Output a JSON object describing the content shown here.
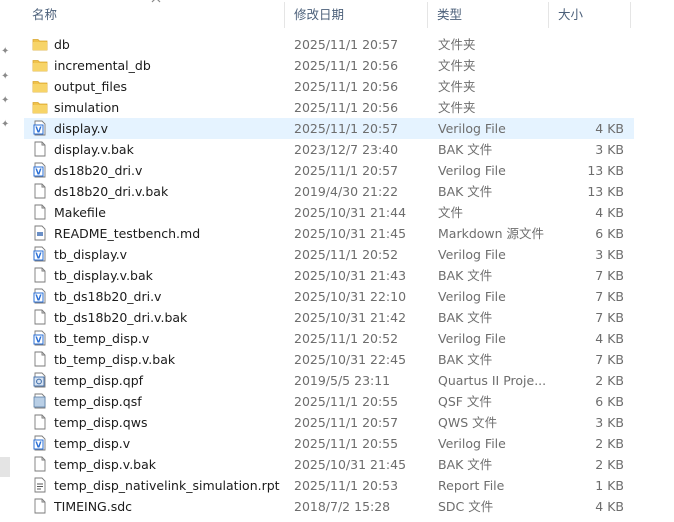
{
  "header": {
    "name": "名称",
    "date": "修改日期",
    "type": "类型",
    "size": "大小"
  },
  "files": [
    {
      "name": "db",
      "date": "2025/11/1 20:57",
      "type": "文件夹",
      "size": "",
      "icon": "folder-icon"
    },
    {
      "name": "incremental_db",
      "date": "2025/11/1 20:56",
      "type": "文件夹",
      "size": "",
      "icon": "folder-icon"
    },
    {
      "name": "output_files",
      "date": "2025/11/1 20:56",
      "type": "文件夹",
      "size": "",
      "icon": "folder-icon"
    },
    {
      "name": "simulation",
      "date": "2025/11/1 20:56",
      "type": "文件夹",
      "size": "",
      "icon": "folder-icon"
    },
    {
      "name": "display.v",
      "date": "2025/11/1 20:57",
      "type": "Verilog File",
      "size": "4 KB",
      "icon": "verilog-file-icon",
      "selected": true
    },
    {
      "name": "display.v.bak",
      "date": "2023/12/7 23:40",
      "type": "BAK 文件",
      "size": "3 KB",
      "icon": "file-icon"
    },
    {
      "name": "ds18b20_dri.v",
      "date": "2025/11/1 20:57",
      "type": "Verilog File",
      "size": "13 KB",
      "icon": "verilog-file-icon"
    },
    {
      "name": "ds18b20_dri.v.bak",
      "date": "2019/4/30 21:22",
      "type": "BAK 文件",
      "size": "13 KB",
      "icon": "file-icon"
    },
    {
      "name": "Makefile",
      "date": "2025/10/31 21:44",
      "type": "文件",
      "size": "4 KB",
      "icon": "file-icon"
    },
    {
      "name": "README_testbench.md",
      "date": "2025/10/31 21:45",
      "type": "Markdown 源文件",
      "size": "6 KB",
      "icon": "markdown-file-icon"
    },
    {
      "name": "tb_display.v",
      "date": "2025/11/1 20:52",
      "type": "Verilog File",
      "size": "3 KB",
      "icon": "verilog-file-icon"
    },
    {
      "name": "tb_display.v.bak",
      "date": "2025/10/31 21:43",
      "type": "BAK 文件",
      "size": "7 KB",
      "icon": "file-icon"
    },
    {
      "name": "tb_ds18b20_dri.v",
      "date": "2025/10/31 22:10",
      "type": "Verilog File",
      "size": "7 KB",
      "icon": "verilog-file-icon"
    },
    {
      "name": "tb_ds18b20_dri.v.bak",
      "date": "2025/10/31 21:42",
      "type": "BAK 文件",
      "size": "7 KB",
      "icon": "file-icon"
    },
    {
      "name": "tb_temp_disp.v",
      "date": "2025/11/1 20:52",
      "type": "Verilog File",
      "size": "4 KB",
      "icon": "verilog-file-icon"
    },
    {
      "name": "tb_temp_disp.v.bak",
      "date": "2025/10/31 22:45",
      "type": "BAK 文件",
      "size": "7 KB",
      "icon": "file-icon"
    },
    {
      "name": "temp_disp.qpf",
      "date": "2019/5/5 23:11",
      "type": "Quartus II Proje...",
      "size": "2 KB",
      "icon": "quartus-project-icon"
    },
    {
      "name": "temp_disp.qsf",
      "date": "2025/11/1 20:55",
      "type": "QSF 文件",
      "size": "6 KB",
      "icon": "qsf-file-icon"
    },
    {
      "name": "temp_disp.qws",
      "date": "2025/11/1 20:57",
      "type": "QWS 文件",
      "size": "3 KB",
      "icon": "file-icon"
    },
    {
      "name": "temp_disp.v",
      "date": "2025/11/1 20:55",
      "type": "Verilog File",
      "size": "2 KB",
      "icon": "verilog-file-icon"
    },
    {
      "name": "temp_disp.v.bak",
      "date": "2025/10/31 21:45",
      "type": "BAK 文件",
      "size": "2 KB",
      "icon": "file-icon"
    },
    {
      "name": "temp_disp_nativelink_simulation.rpt",
      "date": "2025/11/1 20:53",
      "type": "Report File",
      "size": "1 KB",
      "icon": "report-file-icon"
    },
    {
      "name": "TIMEING.sdc",
      "date": "2018/7/2 15:28",
      "type": "SDC 文件",
      "size": "4 KB",
      "icon": "file-icon"
    }
  ],
  "colors": {
    "selected": "#e5f3ff",
    "folder": "#f0c24b",
    "verilog": "#2a6fd6",
    "header_text": "#4c607a"
  }
}
